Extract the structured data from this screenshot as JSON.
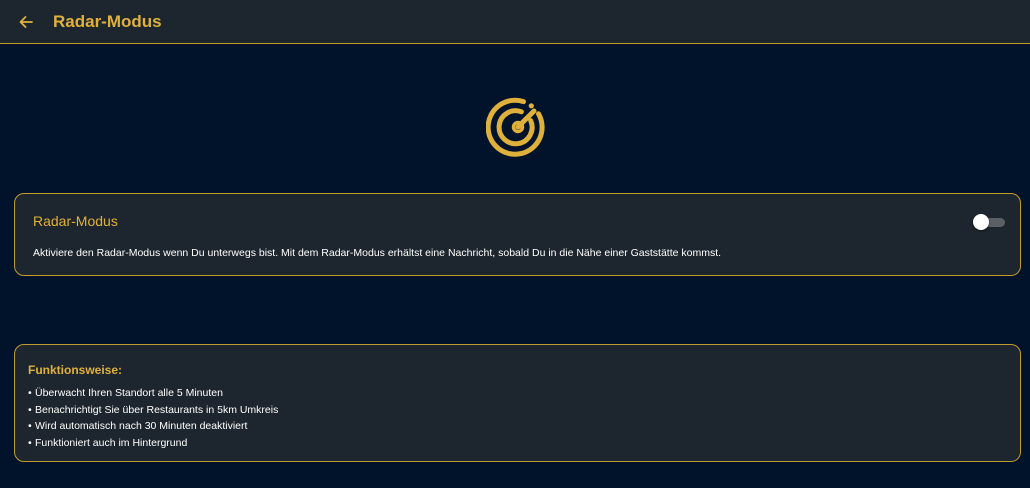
{
  "appbar": {
    "title": "Radar-Modus",
    "back_icon": "arrow-left-icon"
  },
  "hero": {
    "icon": "radar-icon"
  },
  "radar_card": {
    "title": "Radar-Modus",
    "description": "Aktiviere den Radar-Modus wenn Du unterwegs bist. Mit dem Radar-Modus erhältst eine Nachricht, sobald Du in die Nähe einer Gaststätte kommst.",
    "toggle_on": false
  },
  "info_card": {
    "title": "Funktionsweise:",
    "bullet": "•",
    "items": [
      "Überwacht Ihren Standort alle 5 Minuten",
      "Benachrichtigt Sie über Restaurants in 5km Umkreis",
      "Wird automatisch nach 30 Minuten deaktiviert",
      "Funktioniert auch im Hintergrund"
    ]
  },
  "colors": {
    "background": "#00132b",
    "surface": "#1d262e",
    "accent": "#e0b13a",
    "border": "#c49a2e",
    "text": "#ffffff"
  }
}
